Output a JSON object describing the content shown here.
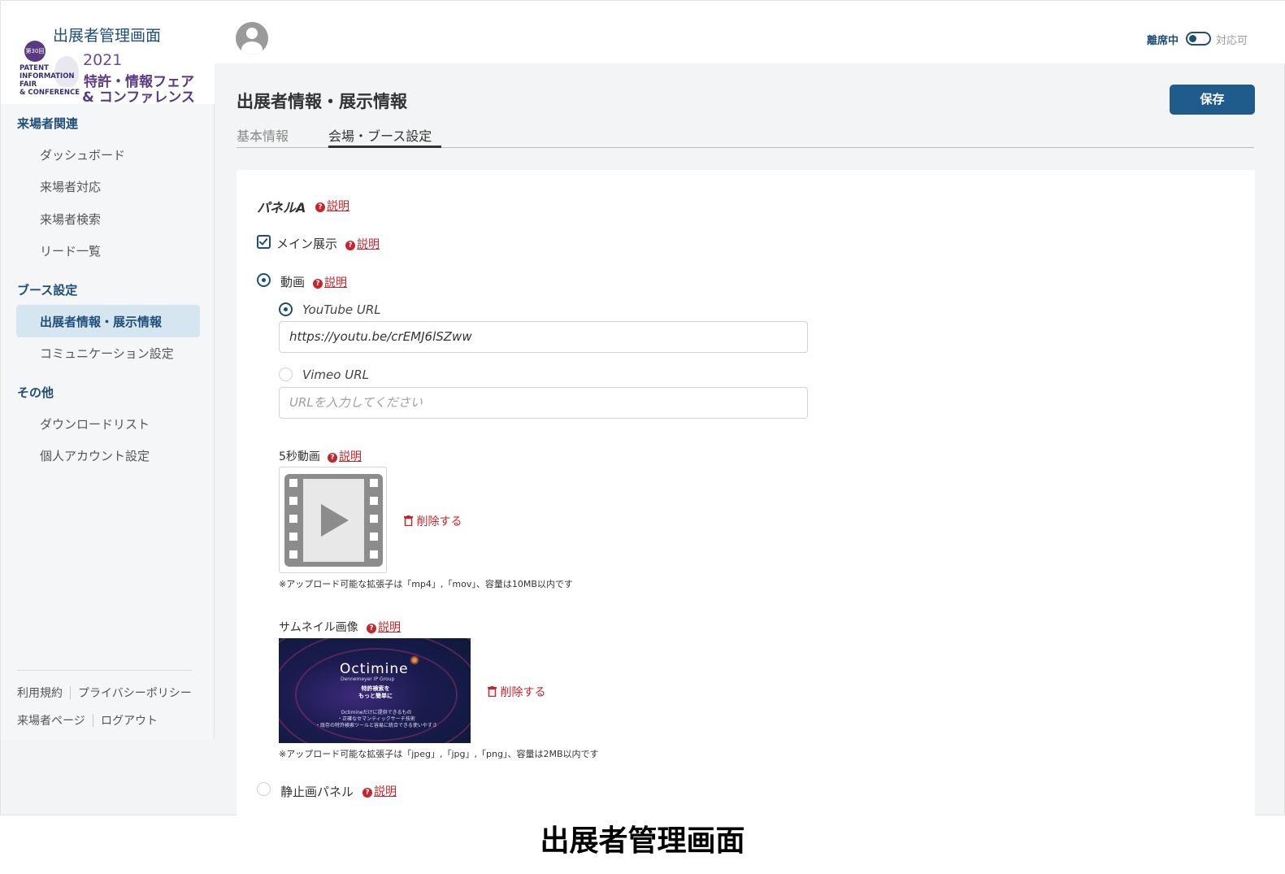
{
  "header": {
    "portal_title": "出展者管理画面",
    "status_away": "離席中",
    "status_available": "対応可"
  },
  "logo": {
    "badge": "第30回",
    "latin_lines": [
      "PATENT",
      "INFORMATION",
      "FAIR",
      "& CONFERENCE"
    ],
    "year": "2021",
    "jp_line1": "特許・情報フェア",
    "jp_line2": "& コンファレンス"
  },
  "sidebar": {
    "sections": [
      {
        "title": "来場者関連",
        "items": [
          "ダッシュボード",
          "来場者対応",
          "来場者検索",
          "リード一覧"
        ]
      },
      {
        "title": "ブース設定",
        "items": [
          "出展者情報・展示情報",
          "コミュニケーション設定"
        ]
      },
      {
        "title": "その他",
        "items": [
          "ダウンロードリスト",
          "個人アカウント設定"
        ]
      }
    ],
    "footer_links": [
      "利用規約",
      "プライバシーポリシー",
      "来場者ページ",
      "ログアウト"
    ]
  },
  "page": {
    "title": "出展者情報・展示情報",
    "save_label": "保存",
    "tabs": [
      {
        "label": "基本情報",
        "active": false
      },
      {
        "label": "会場・ブース設定",
        "active": true
      }
    ]
  },
  "form": {
    "help_label": "説明",
    "panel_title": "パネルA",
    "main_display_label": "メイン展示",
    "main_display_checked": true,
    "video_option_label": "動画",
    "video_selected": true,
    "youtube_label": "YouTube URL",
    "youtube_selected": true,
    "youtube_value": "https://youtu.be/crEMJ6lSZww",
    "vimeo_label": "Vimeo URL",
    "vimeo_selected": false,
    "vimeo_placeholder": "URLを入力してください",
    "five_sec_label": "5秒動画",
    "delete_label": "削除する",
    "video_note": "※アップロード可能な拡張子は「mp4」,「mov」、容量は10MB以内です",
    "thumbnail_label": "サムネイル画像",
    "thumbnail_note": "※アップロード可能な拡張子は「jpeg」,「jpg」,「png」、容量は2MB以内です",
    "thumbnail_brand": "Octimine",
    "thumbnail_subbrand": "Dennemeyer IP Group",
    "thumbnail_jp": "特許検索を\nもっと簡単に",
    "thumbnail_desc": "Octimineだけに提供できるもの\n・正確なセマンティックサーチ技術\n・既存の特許検索ツールと容易に統合できる使いやすさ",
    "still_panel_label": "静止画パネル",
    "still_selected": false
  },
  "caption": "出展者管理画面",
  "colors": {
    "brand_navy": "#1f4e79",
    "save_button": "#1f5c8b",
    "danger_red": "#c8242c",
    "active_nav_bg": "#d6e6f1"
  },
  "icons": [
    "user-avatar-icon",
    "toggle-switch",
    "help-question-icon",
    "checkbox-checked-icon",
    "radio-selected-icon",
    "video-film-icon",
    "trash-icon"
  ]
}
